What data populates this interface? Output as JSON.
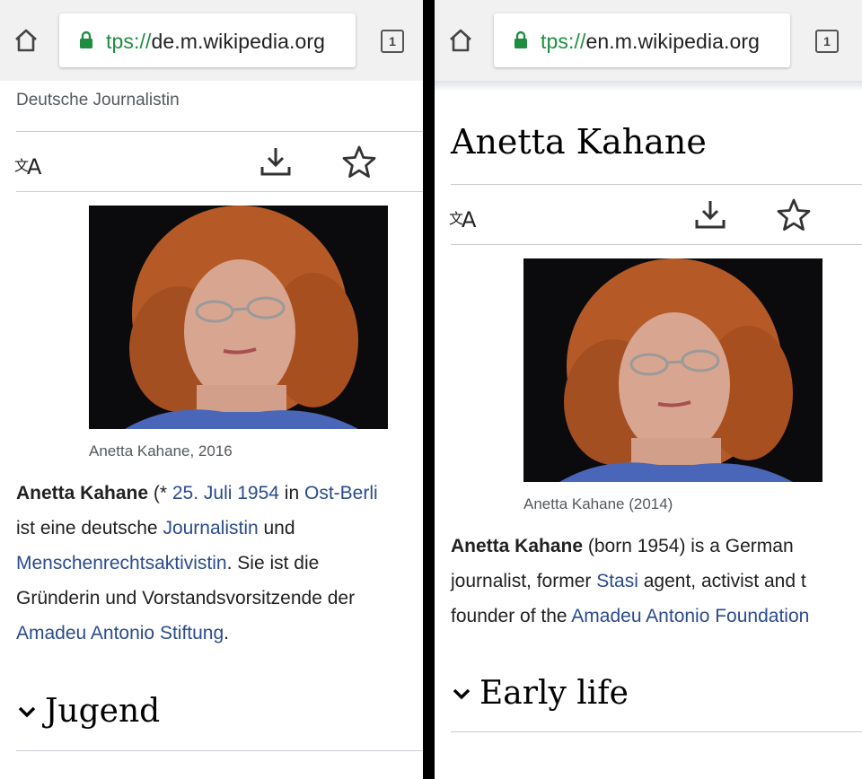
{
  "left": {
    "url": {
      "scheme": "tps://",
      "host": "de.m.wikipedia.org"
    },
    "tab_count": "1",
    "description": "Deutsche Journalistin",
    "image_alt": "Anetta Kahane portrait",
    "caption": "Anetta Kahane, 2016",
    "article": {
      "l1_bold": "Anetta Kahane",
      "l1_a": " (* ",
      "l1_link1": "25. Juli 1954",
      "l1_b": " in ",
      "l1_link2": "Ost-Berli",
      "l2_a": "ist eine deutsche ",
      "l2_link": "Journalistin",
      "l2_b": " und",
      "l3_link": "Menschenrechtsaktivistin",
      "l3_a": ". Sie ist die",
      "l4": "Gründerin und Vorstandsvorsitzende der",
      "l5_link": "Amadeu Antonio Stiftung",
      "l5_a": "."
    },
    "section_title": "Jugend"
  },
  "right": {
    "url": {
      "scheme": "tps://",
      "host": "en.m.wikipedia.org"
    },
    "tab_count": "1",
    "page_title": "Anetta Kahane",
    "image_alt": "Anetta Kahane portrait",
    "caption": "Anetta Kahane (2014)",
    "article": {
      "l1_bold": "Anetta Kahane",
      "l1_a": " (born 1954) is a German",
      "l2_a": "journalist, former ",
      "l2_link": "Stasi",
      "l2_b": " agent, activist and t",
      "l3_a": "founder of the ",
      "l3_link": "Amadeu Antonio Foundation"
    },
    "section_title": "Early life"
  },
  "icons": {
    "home": "home-icon",
    "lock": "lock-icon",
    "tabs": "tab-switcher-icon",
    "language": "language-icon",
    "download": "download-icon",
    "star": "star-icon",
    "chevron": "chevron-down-icon"
  },
  "colors": {
    "link": "#2a4b8d",
    "secure": "#1e8e3e",
    "text": "#202122",
    "muted": "#54595d"
  }
}
